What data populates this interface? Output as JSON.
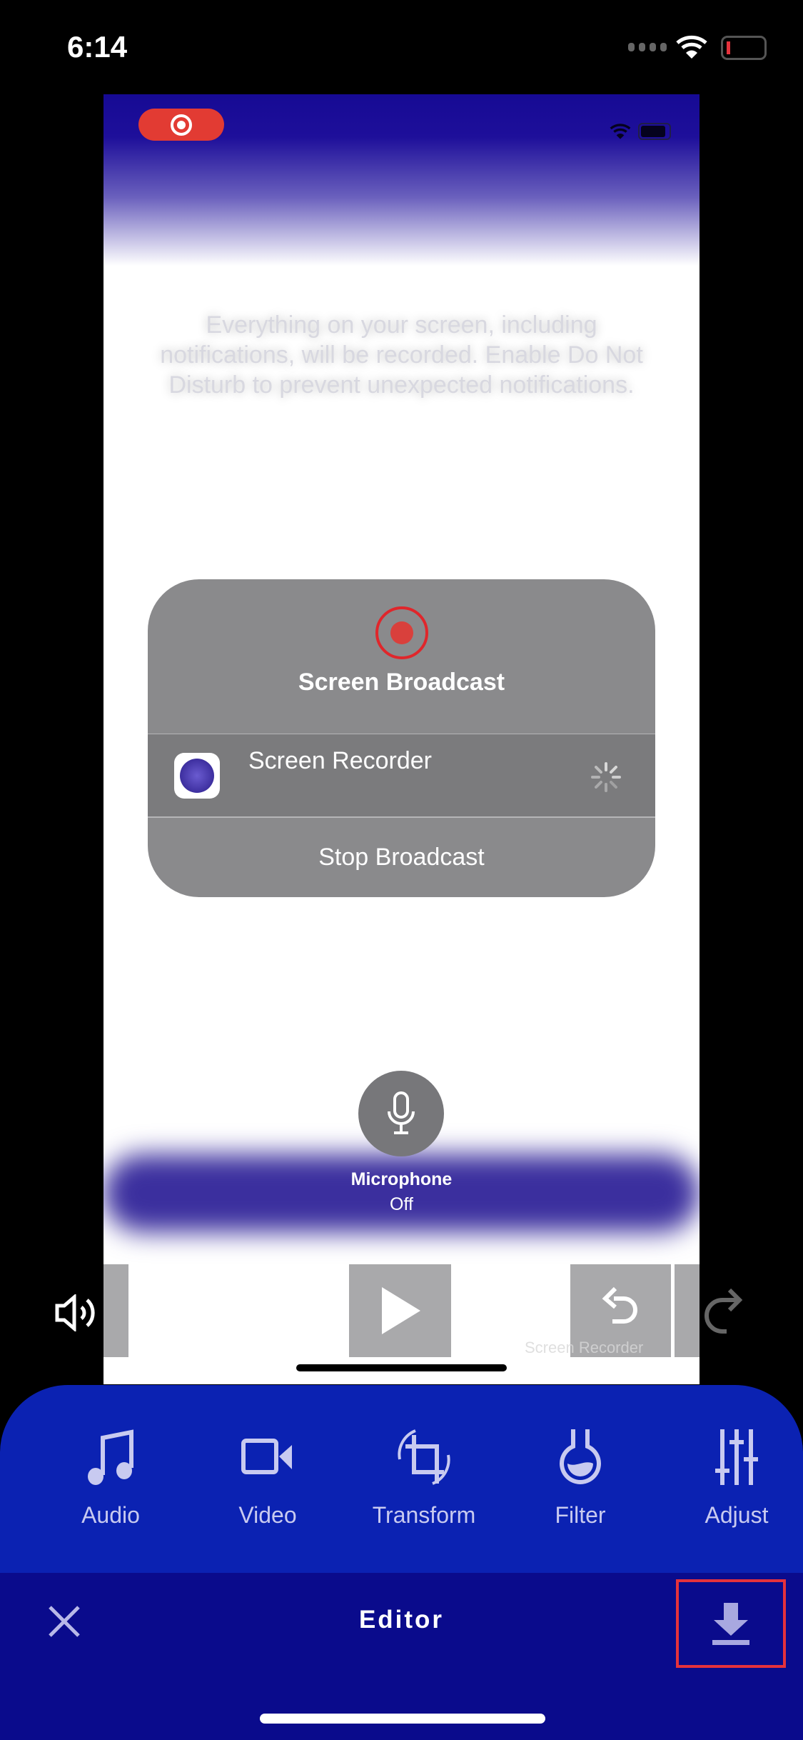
{
  "status_bar": {
    "time": "6:14",
    "battery_color": "#e5323c"
  },
  "recording": {
    "notice": "Everything on your screen, including notifications, will be recorded. Enable Do Not Disturb to prevent unexpected notifications.",
    "dialog_title": "Screen Broadcast",
    "app_name": "Screen Recorder",
    "stop_label": "Stop Broadcast",
    "mic_label": "Microphone",
    "mic_state": "Off",
    "record_color": "#e0262b"
  },
  "player": {
    "watermark": "Screen Recorder",
    "icons": [
      "volume-icon",
      "play-icon",
      "undo-icon",
      "redo-icon"
    ]
  },
  "tools": [
    {
      "label": "Audio",
      "icon": "music-note-icon"
    },
    {
      "label": "Video",
      "icon": "video-camera-icon"
    },
    {
      "label": "Transform",
      "icon": "crop-rotate-icon"
    },
    {
      "label": "Filter",
      "icon": "flask-icon"
    },
    {
      "label": "Adjust",
      "icon": "sliders-icon"
    }
  ],
  "toolbar": {
    "title": "Editor",
    "close_icon": "close-icon",
    "download_icon": "download-icon",
    "highlight_color": "#e5323c"
  },
  "colors": {
    "panel": "#0b22b2",
    "toolbar": "#0a0b8c",
    "icon": "#c8caf0"
  }
}
